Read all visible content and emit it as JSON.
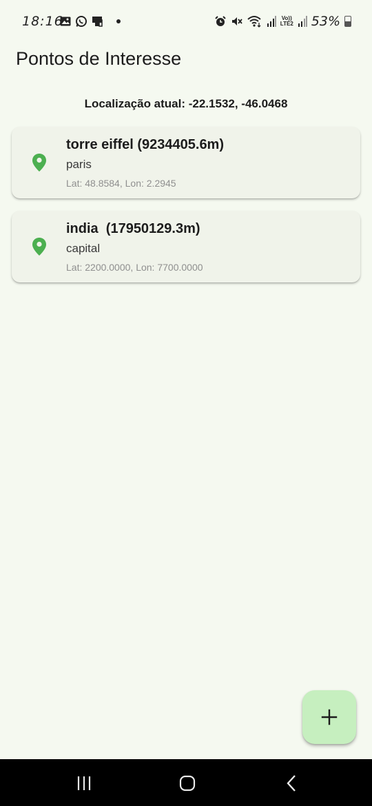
{
  "status_bar": {
    "time": "18:16",
    "battery": "53%",
    "network_badge_top": "Vo))",
    "network_badge_bottom": "LTE2",
    "left_icons": [
      "image-icon",
      "whatsapp-icon",
      "cast-icon",
      "dot-icon"
    ],
    "right_icons": [
      "alarm-icon",
      "mute-icon",
      "wifi-icon",
      "signal-icon",
      "lte-icon",
      "signal-icon",
      "battery-icon"
    ]
  },
  "app_bar": {
    "title": "Pontos de Interesse"
  },
  "location": {
    "text": "Localização atual: -22.1532, -46.0468"
  },
  "poi_items": [
    {
      "title": "torre eiffel (9234405.6m)",
      "description": "paris",
      "coords": "Lat: 48.8584, Lon: 2.2945",
      "icon": "location-pin-icon"
    },
    {
      "title": "india  (17950129.3m)",
      "description": "capital",
      "coords": "Lat: 2200.0000, Lon: 7700.0000",
      "icon": "location-pin-icon"
    }
  ],
  "fab": {
    "icon": "add-icon"
  },
  "nav_bar": {
    "buttons": [
      "recent-apps-icon",
      "home-icon",
      "back-icon"
    ]
  },
  "colors": {
    "background": "#f5f9f0",
    "card": "#f0f3ea",
    "pin": "#4caf50",
    "fab": "#c6efbf",
    "nav_bar": "#000000"
  }
}
